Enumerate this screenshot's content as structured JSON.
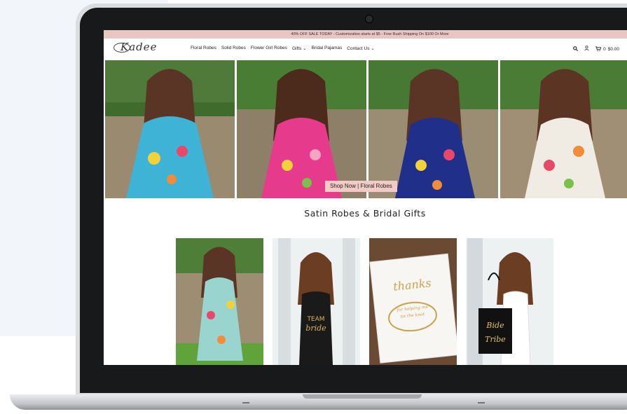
{
  "announcement": "40% OFF SALE TODAY - Customization starts at $5 - Free Rush Shipping On $100 Or More",
  "brand": {
    "logo_text": "Kadee"
  },
  "nav": {
    "items": [
      "Floral Robes",
      "Solid Robes",
      "Flower Girl Robes",
      "Gifts",
      "Bridal Pajamas",
      "Contact Us"
    ],
    "cart_count": "0",
    "cart_total": "$0.00"
  },
  "hero": {
    "cta_label": "Shop Now | Floral Robes",
    "robe_colors": [
      "#3fb3d6",
      "#e63b8c",
      "#1f2f8a",
      "#f1ece3"
    ]
  },
  "section": {
    "title": "Satin Robes & Bridal Gifts"
  },
  "tiles": [
    {
      "alt": "mint floral robe",
      "color": "#9ad4cf"
    },
    {
      "alt": "team bride tank",
      "color": "#1a1a1a",
      "print": "TEAM bride"
    },
    {
      "alt": "thanks bracelet card",
      "color": "#f3f1ec",
      "print": "thanks"
    },
    {
      "alt": "bride tribe tote",
      "color": "#111111",
      "print": "Bride Tribe"
    }
  ],
  "colors": {
    "announcement_bg": "#e8c7c3",
    "cta_bg": "#f2cbc7"
  }
}
